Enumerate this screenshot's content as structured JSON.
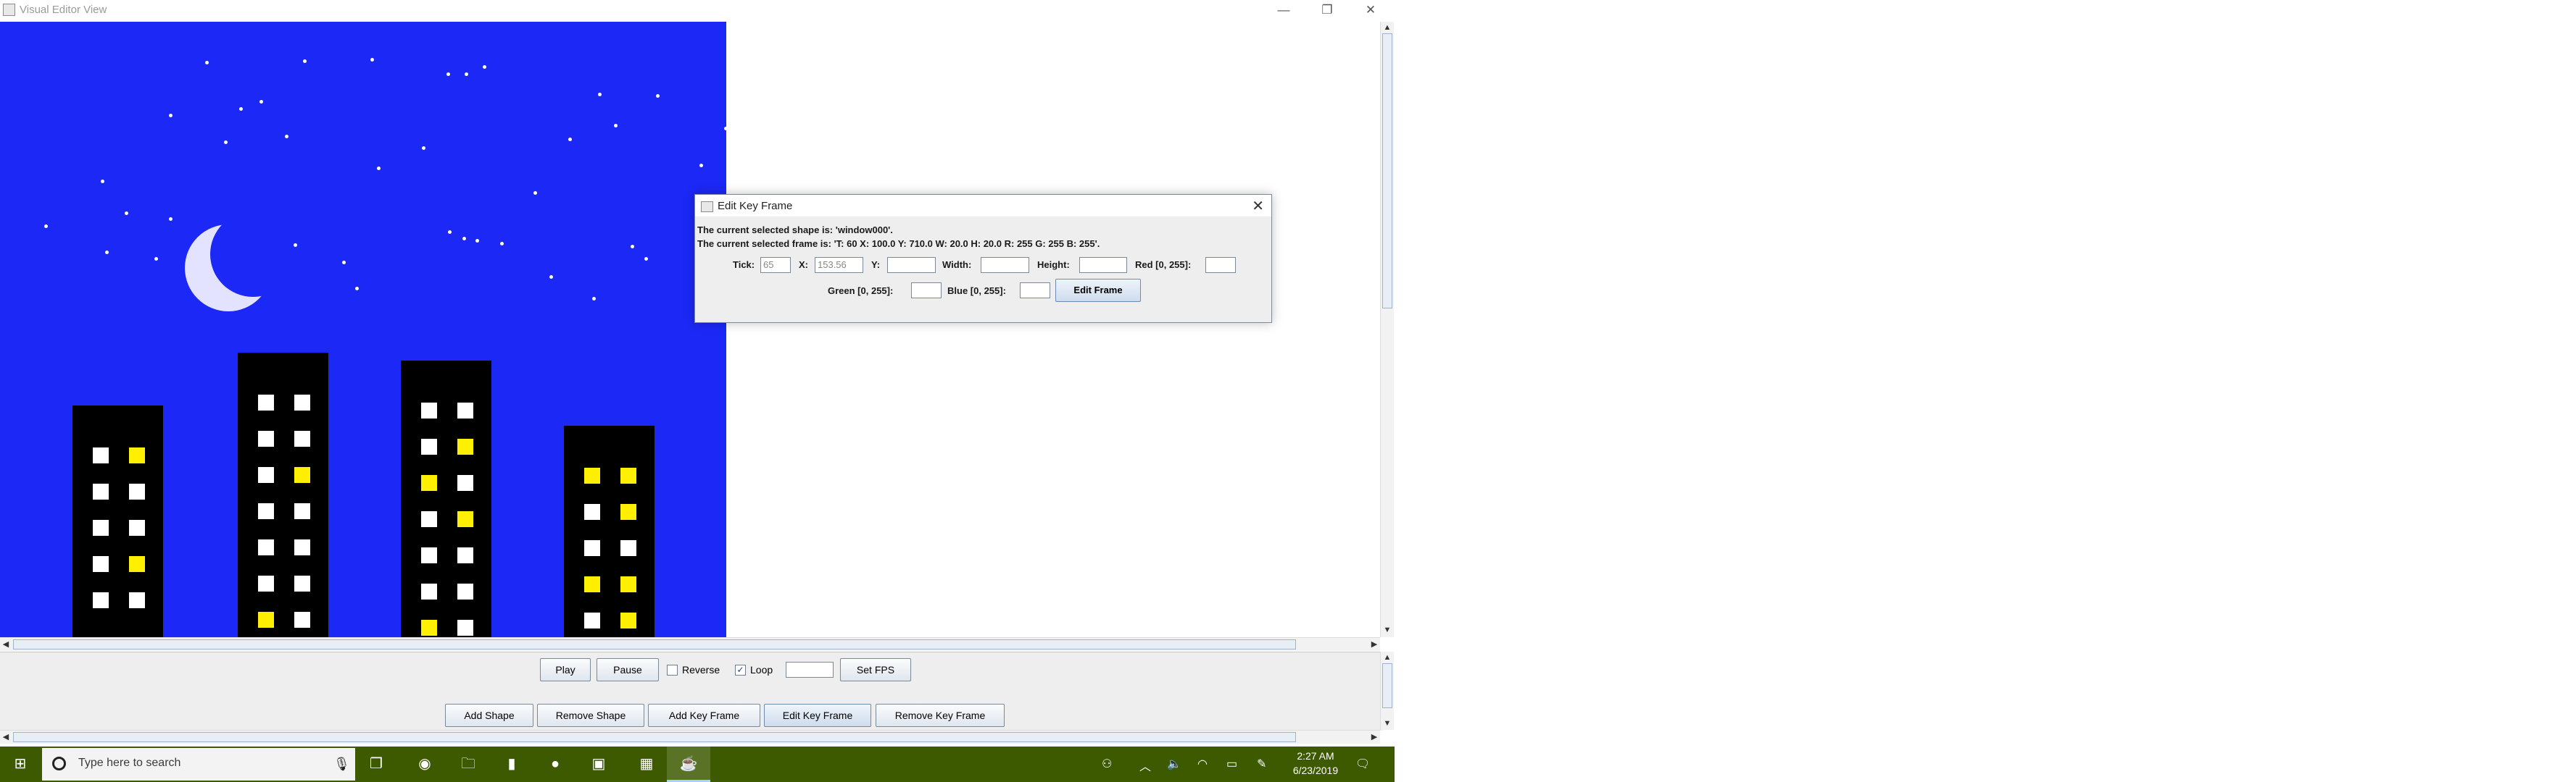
{
  "window": {
    "title": "Visual Editor View",
    "minimize_glyph": "—",
    "restore_glyph": "❐",
    "close_glyph": "✕"
  },
  "controls": {
    "play_label": "Play",
    "pause_label": "Pause",
    "reverse_label": "Reverse",
    "reverse_checked": false,
    "loop_label": "Loop",
    "loop_checked": true,
    "fps_value": "",
    "set_fps_label": "Set FPS",
    "add_shape_label": "Add Shape",
    "remove_shape_label": "Remove Shape",
    "add_key_frame_label": "Add Key Frame",
    "edit_key_frame_label": "Edit Key Frame",
    "remove_key_frame_label": "Remove Key Frame"
  },
  "dialog": {
    "title": "Edit Key Frame",
    "shape_info": "The current selected shape is: 'window000'.",
    "frame_info": "The current selected frame is: 'T: 60 X: 100.0 Y: 710.0 W: 20.0 H: 20.0 R: 255 G: 255 B: 255'.",
    "tick_label": "Tick:",
    "tick_value": "65",
    "x_label": "X:",
    "x_value": "153.56",
    "y_label": "Y:",
    "y_value": "",
    "width_label": "Width:",
    "width_value": "",
    "height_label": "Height:",
    "height_value": "",
    "red_label": "Red [0, 255]:",
    "red_value": "",
    "green_label": "Green [0, 255]:",
    "green_value": "",
    "blue_label": "Blue [0, 255]:",
    "blue_value": "",
    "edit_frame_label": "Edit Frame"
  },
  "taskbar": {
    "search_placeholder": "Type here to search",
    "time": "2:27 AM",
    "date": "6/23/2019"
  },
  "colors": {
    "sky": "#1c28f5",
    "building": "#000000",
    "window_lit": "#ffef00",
    "window_white": "#ffffff",
    "taskbar": "#3d5a00"
  }
}
